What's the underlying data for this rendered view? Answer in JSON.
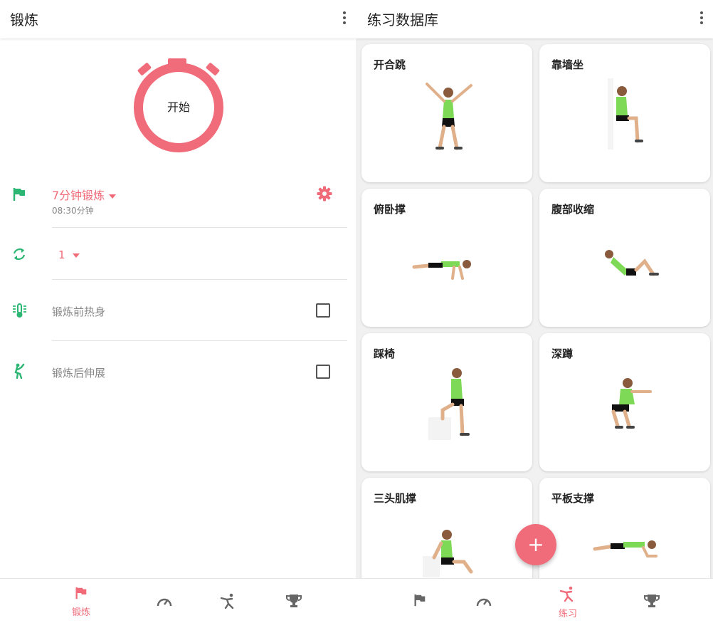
{
  "left": {
    "title": "锻炼",
    "start_label": "开始",
    "workout": {
      "name": "7分钟锻炼",
      "duration": "08:30分钟"
    },
    "rounds": "1",
    "warmup_label": "锻炼前热身",
    "stretch_label": "锻炼后伸展",
    "nav": [
      {
        "icon": "flag-icon",
        "label": "锻炼",
        "active": true
      },
      {
        "icon": "speedometer-icon",
        "label": "",
        "active": false
      },
      {
        "icon": "exercise-icon",
        "label": "",
        "active": false
      },
      {
        "icon": "trophy-icon",
        "label": "",
        "active": false
      }
    ]
  },
  "right": {
    "title": "练习数据库",
    "exercises": [
      {
        "name": "开合跳",
        "pose": "jumping-jack"
      },
      {
        "name": "靠墙坐",
        "pose": "wall-sit"
      },
      {
        "name": "俯卧撑",
        "pose": "push-up"
      },
      {
        "name": "腹部收缩",
        "pose": "crunch"
      },
      {
        "name": "踩椅",
        "pose": "step-up"
      },
      {
        "name": "深蹲",
        "pose": "squat"
      },
      {
        "name": "三头肌撑",
        "pose": "tricep-dip"
      },
      {
        "name": "平板支撑",
        "pose": "plank"
      }
    ],
    "fab_label": "+",
    "nav": [
      {
        "icon": "flag-icon",
        "label": "",
        "active": false
      },
      {
        "icon": "speedometer-icon",
        "label": "",
        "active": false
      },
      {
        "icon": "exercise-icon",
        "label": "练习",
        "active": true
      },
      {
        "icon": "trophy-icon",
        "label": "",
        "active": false
      }
    ]
  },
  "colors": {
    "accent": "#f06a78",
    "green": "#2bb673",
    "gray_icon": "#555555"
  }
}
